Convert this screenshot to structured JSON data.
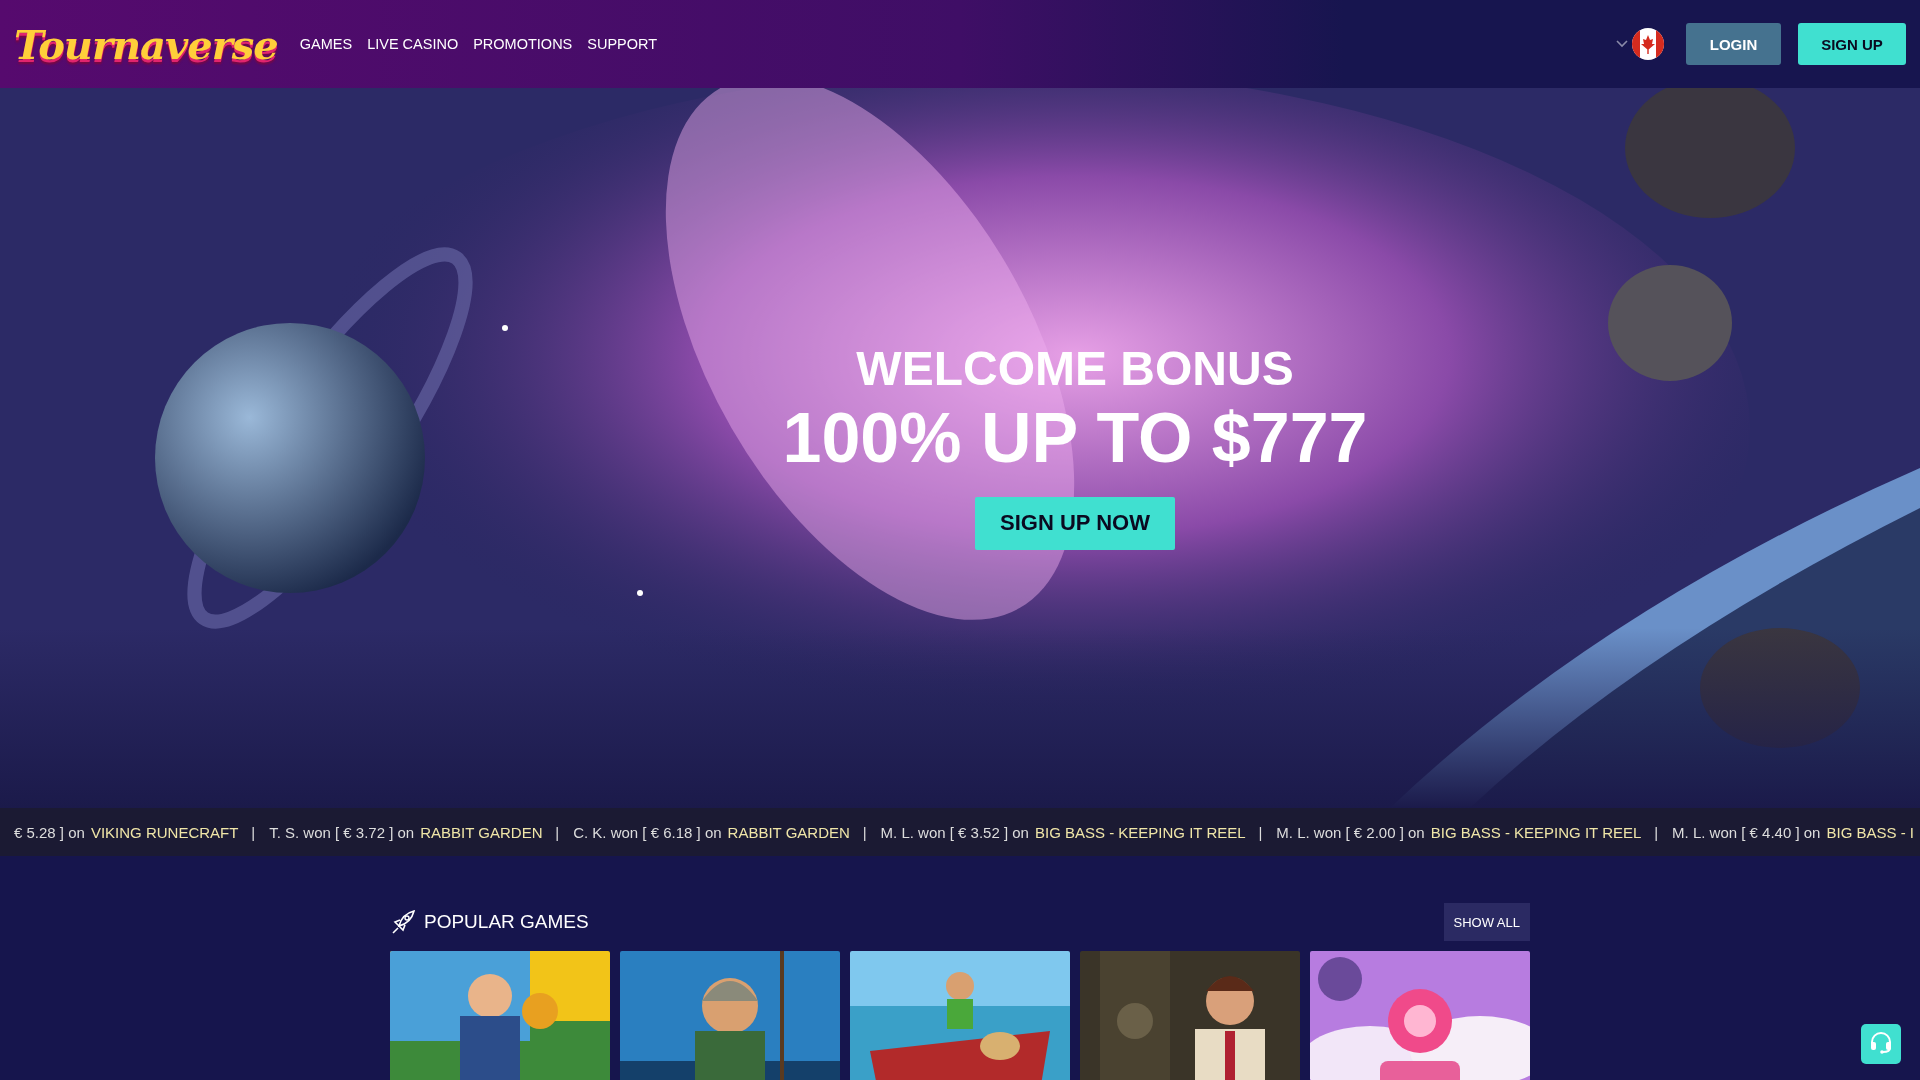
{
  "header": {
    "logo": "Tournaverse",
    "nav": [
      {
        "label": "GAMES"
      },
      {
        "label": "LIVE CASINO"
      },
      {
        "label": "PROMOTIONS"
      },
      {
        "label": "SUPPORT"
      }
    ],
    "login": "LOGIN",
    "signup": "SIGN UP"
  },
  "hero": {
    "kind": "picture",
    "title": "WELCOME BONUS",
    "headline": "100% UP TO $777",
    "cta": "SIGN UP NOW"
  },
  "ticker": [
    {
      "text": "€ 5.28 ] on",
      "game": "VIKING RUNECRAFT"
    },
    {
      "separator": "|",
      "text": "T. S. won [ € 3.72 ] on",
      "game": "RABBIT GARDEN"
    },
    {
      "separator": "|",
      "text": "C. K. won [ € 6.18 ] on",
      "game": "RABBIT GARDEN"
    },
    {
      "separator": "|",
      "text": "M. L. won [ € 3.52 ] on",
      "game": "BIG BASS - KEEPING IT REEL"
    },
    {
      "separator": "|",
      "text": "M. L. won [ € 2.00 ] on",
      "game": "BIG BASS - KEEPING IT REEL"
    },
    {
      "separator": "|",
      "text": "M. L. won [ € 4.40 ] on",
      "game": "BIG BASS - I"
    }
  ],
  "popular": {
    "title": "POPULAR GAMES",
    "show_all": "SHOW ALL"
  }
}
